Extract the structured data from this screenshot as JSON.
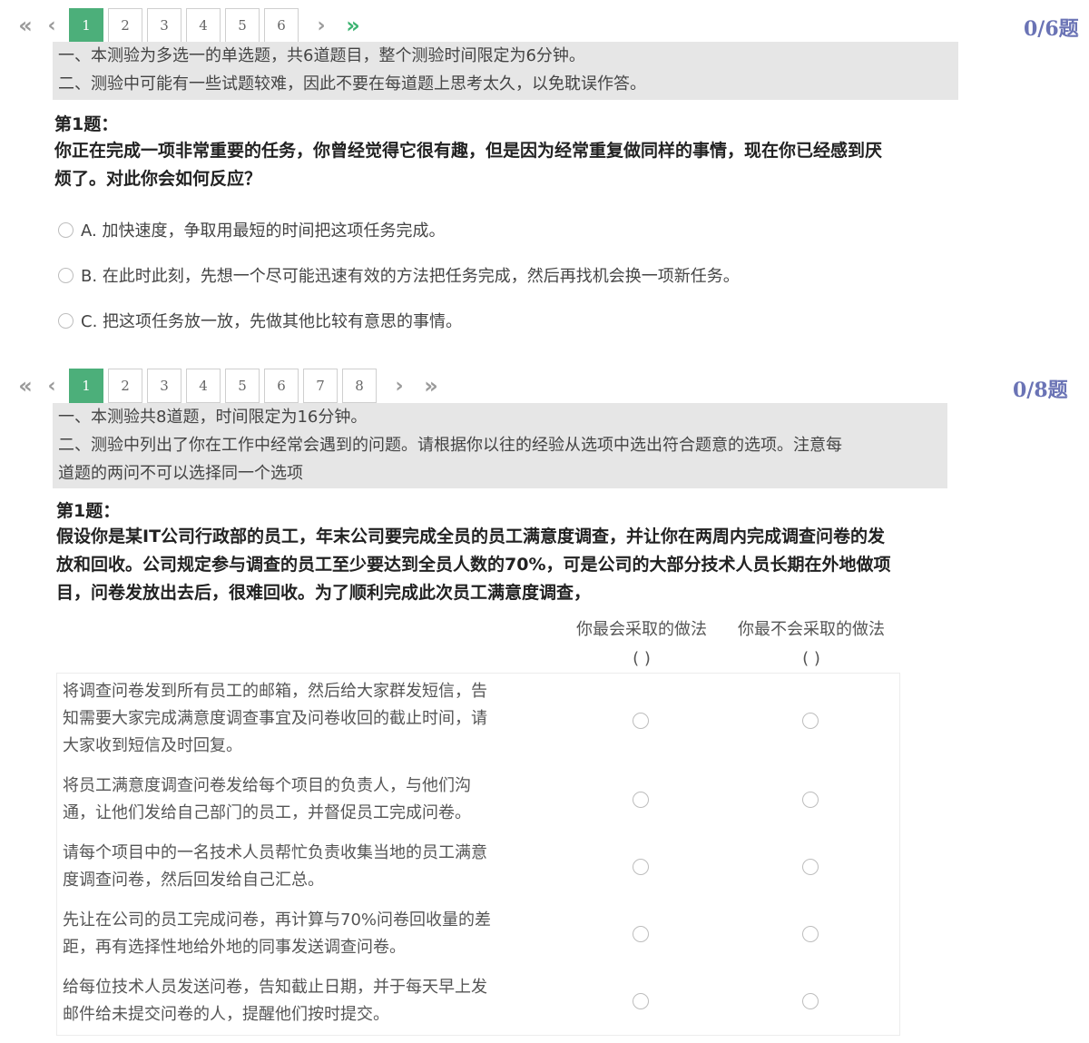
{
  "pager1": {
    "first": "«",
    "prev": "‹",
    "next": "›",
    "last": "»",
    "pages": [
      "1",
      "2",
      "3",
      "4",
      "5",
      "6"
    ],
    "active_page": "1",
    "counter": "0/6题",
    "active_color": "#4caf7a",
    "last_color": "#3cb371"
  },
  "section1": {
    "notice_lines": [
      "一、本测验为多选一的单选题，共6道题目，整个测验时间限定为6分钟。",
      "二、测验中可能有一些试题较难，因此不要在每道题上思考太久，以免耽误作答。"
    ],
    "question_label": "第1题：",
    "question_lines": [
      "你正在完成一项非常重要的任务，你曾经觉得它很有趣，但是因为经常重复做同样的事情，现在你已经感到厌",
      "烦了。对此你会如何反应？"
    ],
    "options": [
      "A. 加快速度，争取用最短的时间把这项任务完成。",
      "B. 在此时此刻，先想一个尽可能迅速有效的方法把任务完成，然后再找机会换一项新任务。",
      "C. 把这项任务放一放，先做其他比较有意思的事情。"
    ]
  },
  "pager2": {
    "first": "«",
    "prev": "‹",
    "next": "›",
    "last": "»",
    "pages": [
      "1",
      "2",
      "3",
      "4",
      "5",
      "6",
      "7",
      "8"
    ],
    "active_page": "1",
    "counter": "0/8题"
  },
  "section2": {
    "notice_lines": [
      "一、本测验共8道题，时间限定为16分钟。",
      "二、测验中列出了你在工作中经常会遇到的问题。请根据你以往的经验从选项中选出符合题意的选项。注意每",
      "道题的两问不可以选择同一个选项"
    ],
    "question_label": "第1题：",
    "question_lines": [
      "假设你是某IT公司行政部的员工，年末公司要完成全员的员工满意度调查，并让你在两周内完成调查问卷的发",
      "放和回收。公司规定参与调查的员工至少要达到全员人数的70%，可是公司的大部分技术人员长期在外地做项",
      "目，问卷发放出去后，很难回收。为了顺利完成此次员工满意度调查，"
    ],
    "column_most": "你最会采取的做法",
    "column_least": "你最不会采取的做法",
    "paren": "(    )",
    "rows": [
      {
        "lines": [
          "将调查问卷发到所有员工的邮箱，然后给大家群发短信，告",
          "知需要大家完成满意度调查事宜及问卷收回的截止时间，请",
          "大家收到短信及时回复。"
        ]
      },
      {
        "lines": [
          "将员工满意度调查问卷发给每个项目的负责人，与他们沟",
          "通，让他们发给自己部门的员工，并督促员工完成问卷。"
        ]
      },
      {
        "lines": [
          "请每个项目中的一名技术人员帮忙负责收集当地的员工满意",
          "度调查问卷，然后回发给自己汇总。"
        ]
      },
      {
        "lines": [
          "先让在公司的员工完成问卷，再计算与70%问卷回收量的差",
          "距，再有选择性地给外地的同事发送调查问卷。"
        ]
      },
      {
        "lines": [
          "给每位技术人员发送问卷，告知截止日期，并于每天早上发",
          "邮件给未提交问卷的人，提醒他们按时提交。"
        ]
      }
    ]
  }
}
